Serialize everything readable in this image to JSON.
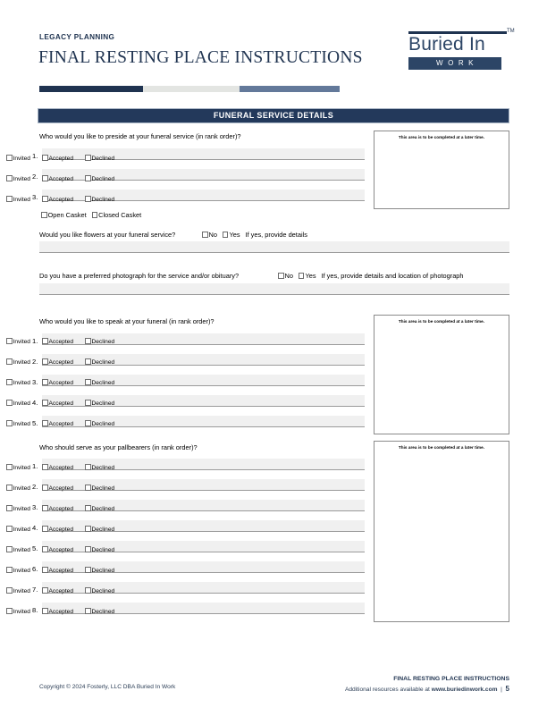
{
  "header": {
    "eyebrow": "LEGACY PLANNING",
    "title": "FINAL RESTING PLACE INSTRUCTIONS",
    "logo": {
      "name": "Buried In",
      "sub": "WORK",
      "tm": "TM"
    },
    "rule_colors": [
      "#1f3350",
      "#e3e5e2",
      "#63799a"
    ]
  },
  "section": {
    "title": "FUNERAL SERVICE DETAILS",
    "bar_color": "#23395b"
  },
  "late_note": "This area is to be completed at a later time.",
  "status_options": [
    "Invited",
    "Accepted",
    "Declined"
  ],
  "blocks": {
    "preside": {
      "question": "Who would you like to preside at your funeral service (in rank order)?",
      "rows": [
        "1.",
        "2.",
        "3."
      ],
      "values": [
        "",
        "",
        ""
      ]
    },
    "casket": {
      "options": [
        "Open Casket",
        "Closed Casket"
      ]
    },
    "flowers": {
      "question": "Would you like flowers at your funeral service?",
      "options": [
        "No",
        "Yes"
      ],
      "hint": "If yes, provide details",
      "value": ""
    },
    "photograph": {
      "question": "Do you have a preferred photograph for the service and/or obituary?",
      "options": [
        "No",
        "Yes"
      ],
      "hint": "If yes, provide details and location of photograph",
      "value": ""
    },
    "speak": {
      "question": "Who would you like to speak at your funeral (in rank order)?",
      "rows": [
        "1.",
        "2.",
        "3.",
        "4.",
        "5."
      ],
      "values": [
        "",
        "",
        "",
        "",
        ""
      ]
    },
    "pallbearers": {
      "question": "Who should serve as your pallbearers (in rank order)?",
      "rows": [
        "1.",
        "2.",
        "3.",
        "4.",
        "5.",
        "6.",
        "7.",
        "8."
      ],
      "values": [
        "",
        "",
        "",
        "",
        "",
        "",
        "",
        ""
      ]
    }
  },
  "footer": {
    "copyright": "Copyright © 2024 Fosterly, LLC DBA Buried In Work",
    "title": "FINAL RESTING PLACE INSTRUCTIONS",
    "resources_prefix": "Additional resources available at ",
    "website": "www.buriedinwork.com",
    "separator": "|",
    "page": "5"
  }
}
